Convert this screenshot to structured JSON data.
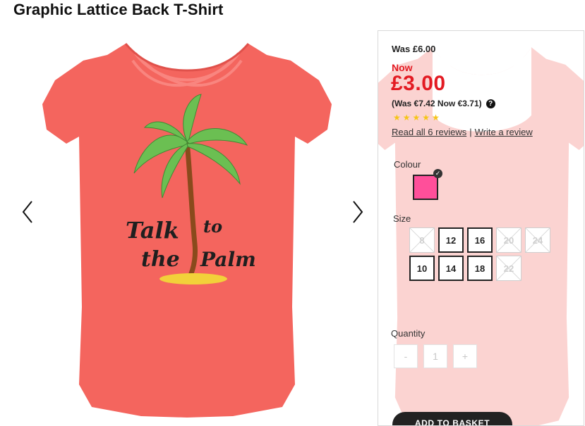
{
  "product": {
    "title": "Graphic Lattice Back T-Shirt",
    "shirt_color": "#f4655e",
    "print_text_line1_left": "Talk",
    "print_text_line1_right": "to",
    "print_text_line2_left": "the",
    "print_text_line2_right": "Palm"
  },
  "gallery": {
    "prev_icon": "chevron-left-icon",
    "next_icon": "chevron-right-icon"
  },
  "pricing": {
    "was": "Was £6.00",
    "now_label": "Now",
    "now_price": "£3.00",
    "euro": "(Was €7.42 Now €3.71)",
    "help_icon_glyph": "?",
    "accent_color": "#e31b23"
  },
  "rating": {
    "stars": 5,
    "read_reviews": "Read all 6 reviews",
    "separator": "|",
    "write_review": "Write a review"
  },
  "colour": {
    "label": "Colour",
    "selected_hex": "#ff4f9a"
  },
  "size": {
    "label": "Size",
    "options": [
      {
        "label": "8",
        "available": false
      },
      {
        "label": "12",
        "available": true
      },
      {
        "label": "16",
        "available": true
      },
      {
        "label": "20",
        "available": false
      },
      {
        "label": "24",
        "available": false
      },
      {
        "label": "10",
        "available": true
      },
      {
        "label": "14",
        "available": true
      },
      {
        "label": "18",
        "available": true
      },
      {
        "label": "22",
        "available": false
      }
    ]
  },
  "quantity": {
    "label": "Quantity",
    "minus": "-",
    "value": "1",
    "plus": "+"
  },
  "actions": {
    "add_to_basket": "ADD TO BASKET"
  }
}
